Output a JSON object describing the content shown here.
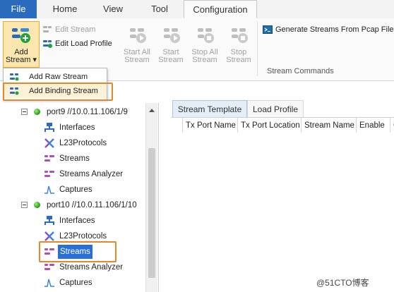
{
  "ribbon_tabs": [
    {
      "label": "File"
    },
    {
      "label": "Home"
    },
    {
      "label": "View"
    },
    {
      "label": "Tool"
    },
    {
      "label": "Configuration"
    }
  ],
  "ribbon": {
    "add_stream_line1": "Add",
    "add_stream_line2": "Stream ▾",
    "edit_stream": "Edit Stream",
    "edit_load_profile": "Edit Load Profile",
    "start_all_1": "Start All",
    "start_all_2": "Stream",
    "start_1": "Start",
    "start_2": "Stream",
    "stop_all_1": "Stop All",
    "stop_all_2": "Stream",
    "stop_1": "Stop",
    "stop_2": "Stream",
    "generate_pcap": "Generate Streams From Pcap File",
    "group_label": "Stream Commands"
  },
  "menu": {
    "items": [
      {
        "label": "Add Raw Stream"
      },
      {
        "label": "Add Binding Stream"
      }
    ]
  },
  "tree": {
    "port9": "port9 //10.0.11.106/1/9",
    "port10": "port10 //10.0.11.106/1/10",
    "children": [
      "Interfaces",
      "L23Protocols",
      "Streams",
      "Streams Analyzer",
      "Captures"
    ]
  },
  "panel": {
    "tabs": [
      "Stream Template",
      "Load Profile"
    ],
    "columns": [
      "Tx Port Name",
      "Tx Port Location",
      "Stream Name",
      "Enable",
      "C"
    ]
  },
  "watermark": "@51CTO博客",
  "colors": {
    "file_tab": "#2b6bbd",
    "highlight_orange": "#e8862c",
    "selection_blue": "#2a6fd6",
    "status_green": "#1a9a12"
  }
}
